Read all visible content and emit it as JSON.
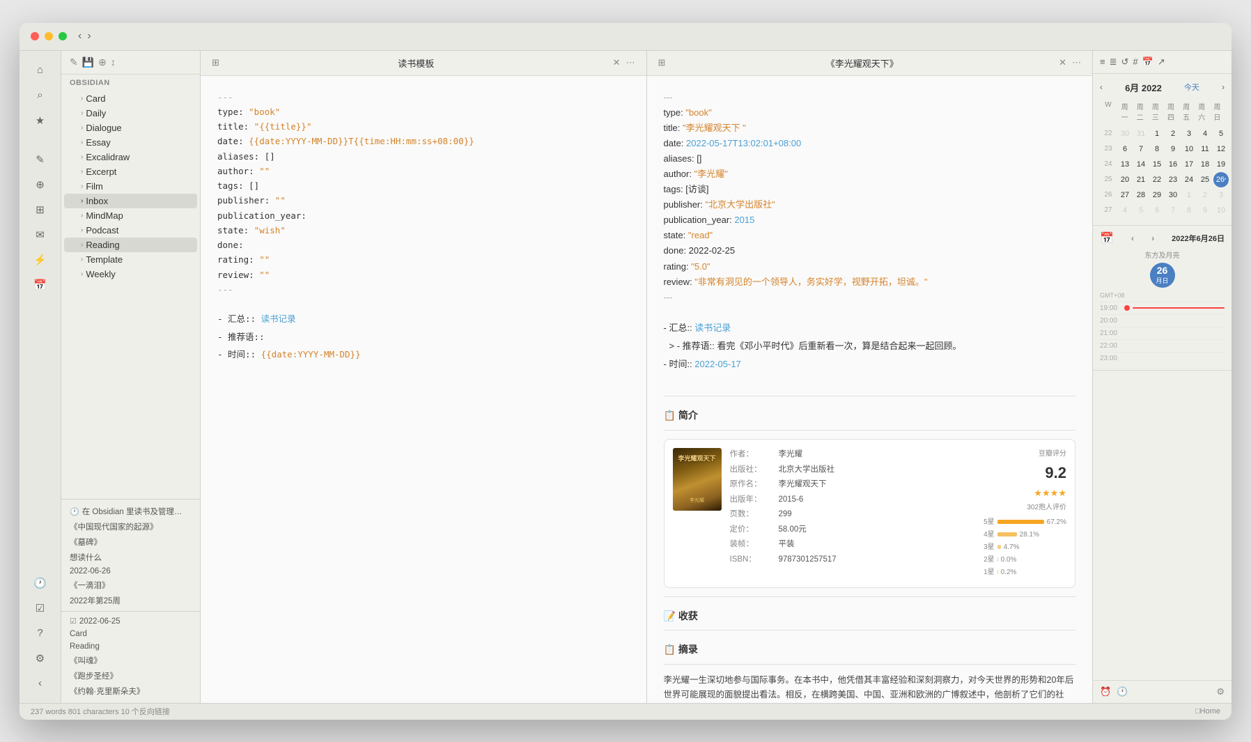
{
  "window": {
    "title": "Obsidian"
  },
  "titlebar": {
    "back": "‹",
    "forward": "›"
  },
  "sidebar": {
    "icons": [
      "⌂",
      "⊞",
      "★",
      "✎",
      "⇔",
      "📁",
      "✉",
      "⚡",
      "📅"
    ],
    "obsidian_label": "OBSIDIAN",
    "toolbar_icons": [
      "✎",
      "💾",
      "⊕",
      "↕"
    ]
  },
  "filetree": {
    "items": [
      {
        "label": "Card",
        "indent": 1,
        "arrow": "›"
      },
      {
        "label": "Daily",
        "indent": 1,
        "arrow": "›"
      },
      {
        "label": "Dialogue",
        "indent": 1,
        "arrow": "›"
      },
      {
        "label": "Essay",
        "indent": 1,
        "arrow": "›"
      },
      {
        "label": "Excalidraw",
        "indent": 1,
        "arrow": "›"
      },
      {
        "label": "Excerpt",
        "indent": 1,
        "arrow": "›"
      },
      {
        "label": "Film",
        "indent": 1,
        "arrow": "›"
      },
      {
        "label": "Inbox",
        "indent": 1,
        "arrow": "›",
        "active": true
      },
      {
        "label": "MindMap",
        "indent": 1,
        "arrow": "›"
      },
      {
        "label": "Podcast",
        "indent": 1,
        "arrow": "›"
      },
      {
        "label": "Reading",
        "indent": 1,
        "arrow": "›",
        "selected": true
      },
      {
        "label": "Template",
        "indent": 1,
        "arrow": "›"
      },
      {
        "label": "Weekly",
        "indent": 1,
        "arrow": "›"
      }
    ]
  },
  "recent": [
    {
      "label": "在 Obsidian 里读书及管理…",
      "icon": "🕐"
    },
    {
      "label": "《中国现代国家的起源》"
    },
    {
      "label": "《墓碑》"
    },
    {
      "label": "想读什么"
    },
    {
      "label": "2022-06-26"
    },
    {
      "label": "《一滴泪》"
    },
    {
      "label": "2022年第25周"
    },
    {
      "label": "《叫魂》"
    },
    {
      "label": "2022-06-25"
    },
    {
      "label": "Card"
    },
    {
      "label": "Reading"
    },
    {
      "label": "《叫魂》"
    },
    {
      "label": "《跑步圣经》"
    },
    {
      "label": "《约翰·克里斯朵夫》"
    }
  ],
  "panel_left": {
    "title": "读书模板",
    "header_icons": [
      "⊞",
      "✕",
      "⋯"
    ],
    "content": {
      "separator1": "---",
      "yaml_lines": [
        {
          "raw": "type: ",
          "key": "type",
          "value": "\"book\"",
          "value_type": "string"
        },
        {
          "raw": "title: ",
          "key": "title",
          "value": "\"{{title}}\"",
          "value_type": "template"
        },
        {
          "raw": "date: {{date:YYYY-MM-DD}}T{{time:HH:mm:ss+08:00}}",
          "key": "date",
          "value": "",
          "value_type": "template_date"
        },
        {
          "raw": "aliases: []",
          "key": "aliases",
          "value": "[]",
          "value_type": "plain"
        },
        {
          "raw": "author: ",
          "key": "author",
          "value": "\"\"",
          "value_type": "string"
        },
        {
          "raw": "tags: []",
          "key": "tags",
          "value": "[]",
          "value_type": "plain"
        },
        {
          "raw": "publisher: ",
          "key": "publisher",
          "value": "\"\"",
          "value_type": "string"
        },
        {
          "raw": "publication_year:",
          "key": "publication_year",
          "value": "",
          "value_type": "plain"
        },
        {
          "raw": "state: ",
          "key": "state",
          "value": "\"wish\"",
          "value_type": "string"
        },
        {
          "raw": "done:",
          "key": "done",
          "value": "",
          "value_type": "plain"
        },
        {
          "raw": "rating: ",
          "key": "rating",
          "value": "\"\"",
          "value_type": "string"
        },
        {
          "raw": "review: ",
          "key": "review",
          "value": "\"\"",
          "value_type": "string"
        }
      ],
      "separator2": "---",
      "list_items": [
        "- 汇总:: 读书记录",
        "- 推荐语::",
        "- 时间:: {{date:YYYY-MM-DD}}"
      ]
    }
  },
  "panel_right": {
    "title": "《李光耀观天下》",
    "header_icons": [
      "⊞",
      "✕",
      "⋯"
    ],
    "content": {
      "separator1": "---",
      "yaml_lines": [
        {
          "key": "type",
          "value": "\"book\"",
          "type": "string"
        },
        {
          "key": "title",
          "value": "\"李光耀观天下 \"",
          "type": "string"
        },
        {
          "key": "date",
          "value": "2022-05-17T13:02:01+08:00",
          "type": "date"
        },
        {
          "key": "aliases",
          "value": "[]",
          "type": "plain"
        },
        {
          "key": "author",
          "value": "\"李光耀\"",
          "type": "string"
        },
        {
          "key": "tags",
          "value": "[访谈]",
          "type": "plain"
        },
        {
          "key": "publisher",
          "value": "\"北京大学出版社\"",
          "type": "string"
        },
        {
          "key": "publication_year",
          "value": "2015",
          "type": "number"
        },
        {
          "key": "state",
          "value": "\"read\"",
          "type": "string"
        },
        {
          "key": "done",
          "value": "2022-02-25",
          "type": "plain"
        },
        {
          "key": "rating",
          "value": "\"5.0\"",
          "type": "rating"
        },
        {
          "key": "review",
          "value": "\"非常有洞见的一个领导人，务实好学，视野开拓，坦诚。\"",
          "type": "string"
        }
      ],
      "separator2": "---",
      "list_items": [
        "- 汇总:: 读书记录",
        "> - 推荐语:: 看完《邓小平时代》后重新看一次，算是结合起来一起回顾。",
        "- 时间:: 2022-05-17"
      ]
    },
    "sections": {
      "intro_heading": "📋 简介",
      "book": {
        "title": "李光耀观天下",
        "author": "作者：李光耀",
        "publisher": "出版社：北京大学出版社",
        "original_title": "原作名：李光耀观天下",
        "year": "出版年：2015-6",
        "pages": "页数：299",
        "price": "定价：58.00元",
        "binding": "装帧：平装",
        "isbn": "ISBN：9787301257517"
      },
      "rating": {
        "score": "9.2",
        "stars": "★★★★",
        "count": "302抱人评价",
        "bars": [
          {
            "label": "5星",
            "percent": "67.2%",
            "width": 67
          },
          {
            "label": "4星",
            "percent": "28.1%",
            "width": 28
          },
          {
            "label": "3星",
            "percent": "4.7%",
            "width": 5
          },
          {
            "label": "2星",
            "percent": "0.0%",
            "width": 0
          },
          {
            "label": "1星",
            "percent": "0.2%",
            "width": 1
          }
        ]
      },
      "description": "李光耀一生深切地参与国际事务。在本书中，他凭借其丰富经验和深刻洞察力，对今天世界的形势和20年后世界可能展现的面貌提出看法。相反，在横跨美国、中国、亚洲和欧洲的广博叙述中，他剖析了它们的社会、探究其人民的心理，并提出了有关这些国家未来的结论。"
    }
  },
  "right_sidebar": {
    "toolbar_icons": [
      "≡",
      "≣",
      "↺",
      "#",
      "📅",
      "↗"
    ],
    "calendar": {
      "title": "6月 2022",
      "today_btn": "今天",
      "weekdays": [
        "W",
        "周一",
        "周二",
        "周三",
        "周四",
        "周五",
        "周六",
        "周日"
      ],
      "weeks": [
        {
          "num": 22,
          "days": [
            {
              "d": 30,
              "other": true
            },
            {
              "d": 31,
              "other": true
            },
            {
              "d": 1
            },
            {
              "d": 2
            },
            {
              "d": 3
            },
            {
              "d": 4
            },
            {
              "d": 5
            }
          ]
        },
        {
          "num": 23,
          "days": [
            {
              "d": 6
            },
            {
              "d": 7
            },
            {
              "d": 8
            },
            {
              "d": 9
            },
            {
              "d": 10
            },
            {
              "d": 11
            },
            {
              "d": 12
            }
          ]
        },
        {
          "num": 24,
          "days": [
            {
              "d": 13
            },
            {
              "d": 14
            },
            {
              "d": 15
            },
            {
              "d": 16
            },
            {
              "d": 17
            },
            {
              "d": 18
            },
            {
              "d": 19
            }
          ]
        },
        {
          "num": 25,
          "days": [
            {
              "d": 20
            },
            {
              "d": 21
            },
            {
              "d": 22
            },
            {
              "d": 23
            },
            {
              "d": 24
            },
            {
              "d": 25
            },
            {
              "d": 26,
              "today": true,
              "dot": true
            }
          ]
        },
        {
          "num": 26,
          "days": [
            {
              "d": 27
            },
            {
              "d": 28
            },
            {
              "d": 29
            },
            {
              "d": 30
            },
            {
              "d": 1,
              "other": true
            },
            {
              "d": 2,
              "other": true
            },
            {
              "d": 3,
              "other": true
            }
          ]
        },
        {
          "num": 27,
          "days": [
            {
              "d": 4,
              "other": true
            },
            {
              "d": 5,
              "other": true
            },
            {
              "d": 6,
              "other": true
            },
            {
              "d": 7,
              "other": true
            },
            {
              "d": 8,
              "other": true
            },
            {
              "d": 9,
              "other": true
            },
            {
              "d": 10,
              "other": true
            }
          ]
        }
      ]
    },
    "day_view": {
      "prev": "‹",
      "next": "›",
      "title": "2022年6月26日",
      "subtitle": "东方及月亮",
      "day_number": "26",
      "day_sub": "月日",
      "tz": "GMT+08",
      "current_time": "19:00",
      "time_slots": [
        "20:00",
        "21:00",
        "22:00",
        "23:00"
      ]
    }
  },
  "status_bar": {
    "stats": "237 words  801 characters  10 个反向链接",
    "location": "□Home"
  }
}
